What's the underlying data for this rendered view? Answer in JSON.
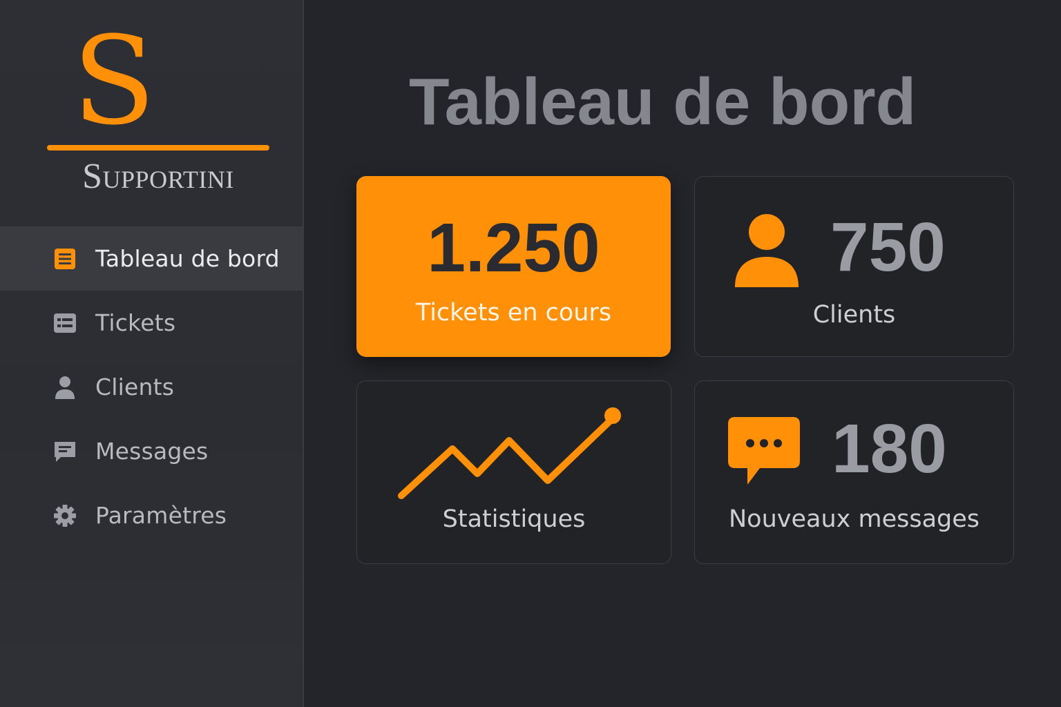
{
  "brand": {
    "letter": "S",
    "name": "Supportini",
    "accent_color": "#ff9008"
  },
  "sidebar": {
    "items": [
      {
        "label": "Tableau de bord",
        "icon": "dashboard-list-icon",
        "active": true
      },
      {
        "label": "Tickets",
        "icon": "tickets-icon",
        "active": false
      },
      {
        "label": "Clients",
        "icon": "user-icon",
        "active": false
      },
      {
        "label": "Messages",
        "icon": "message-icon",
        "active": false
      },
      {
        "label": "Paramètres",
        "icon": "gear-icon",
        "active": false
      }
    ]
  },
  "main": {
    "title": "Tableau de bord",
    "cards": {
      "tickets": {
        "value": "1.250",
        "label": "Tickets en cours"
      },
      "clients": {
        "value": "750",
        "label": "Clients",
        "icon": "user-icon"
      },
      "stats": {
        "label": "Statistiques",
        "icon": "trend-line-icon"
      },
      "messages": {
        "value": "180",
        "label": "Nouveaux messages",
        "icon": "chat-bubble-icon"
      }
    }
  }
}
